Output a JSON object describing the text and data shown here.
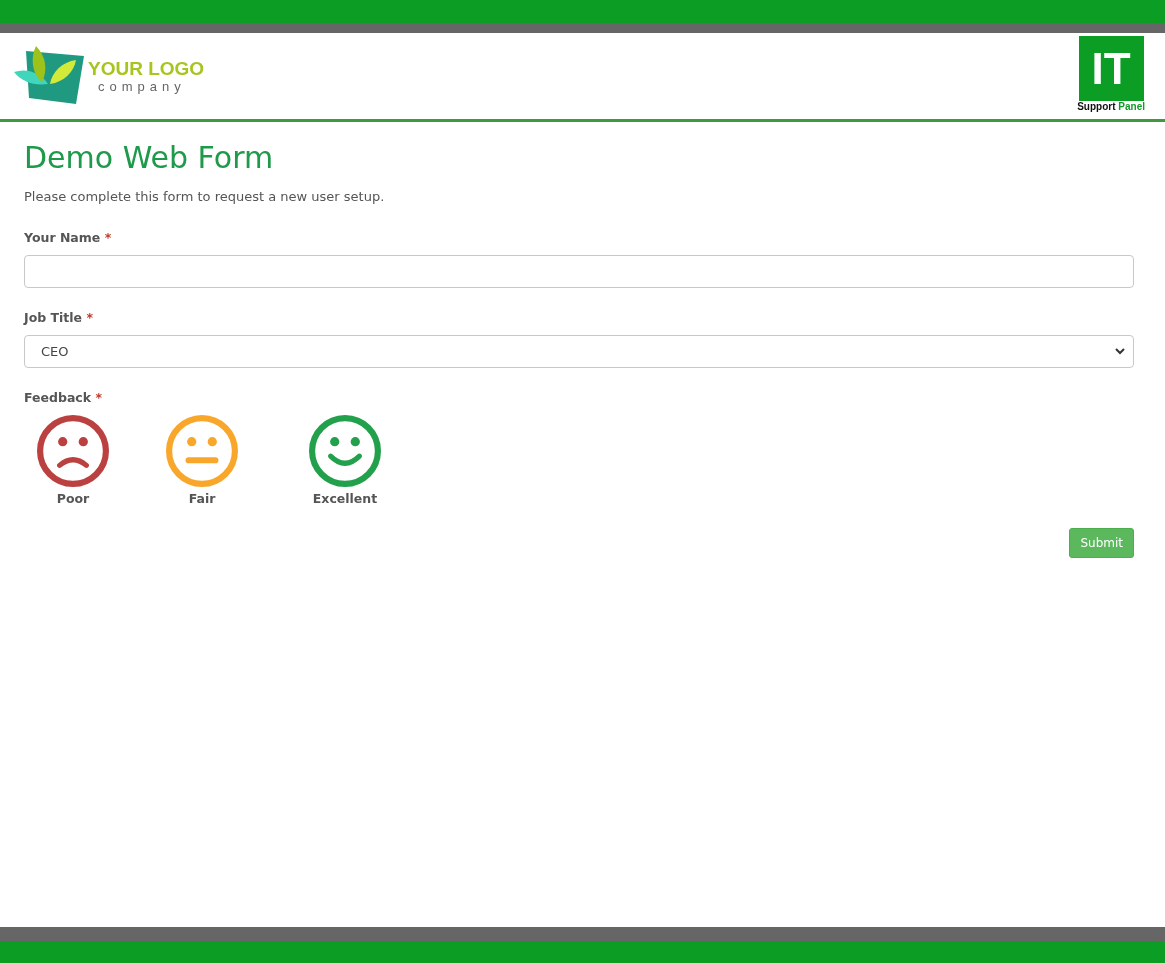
{
  "header": {
    "logo": {
      "name": "YOUR LOGO",
      "tagline": "company"
    },
    "badge": {
      "mark": "IT",
      "caption_1": "Support",
      "caption_2": "Panel"
    }
  },
  "form": {
    "title": "Demo Web Form",
    "intro": "Please complete this form to request a new user setup.",
    "fields": [
      {
        "kind": "text",
        "label": "Your Name",
        "required": "*"
      },
      {
        "kind": "select",
        "label": "Job Title",
        "required": "*",
        "value": "CEO"
      }
    ],
    "feedback": {
      "label": "Feedback",
      "required": "*",
      "options": [
        {
          "kind": "sad",
          "label": "Poor",
          "color": "#bb4040"
        },
        {
          "kind": "neutral",
          "label": "Fair",
          "color": "#f9a72b"
        },
        {
          "kind": "happy",
          "label": "Excellent",
          "color": "#22a04b"
        }
      ]
    },
    "submit": "Submit"
  }
}
